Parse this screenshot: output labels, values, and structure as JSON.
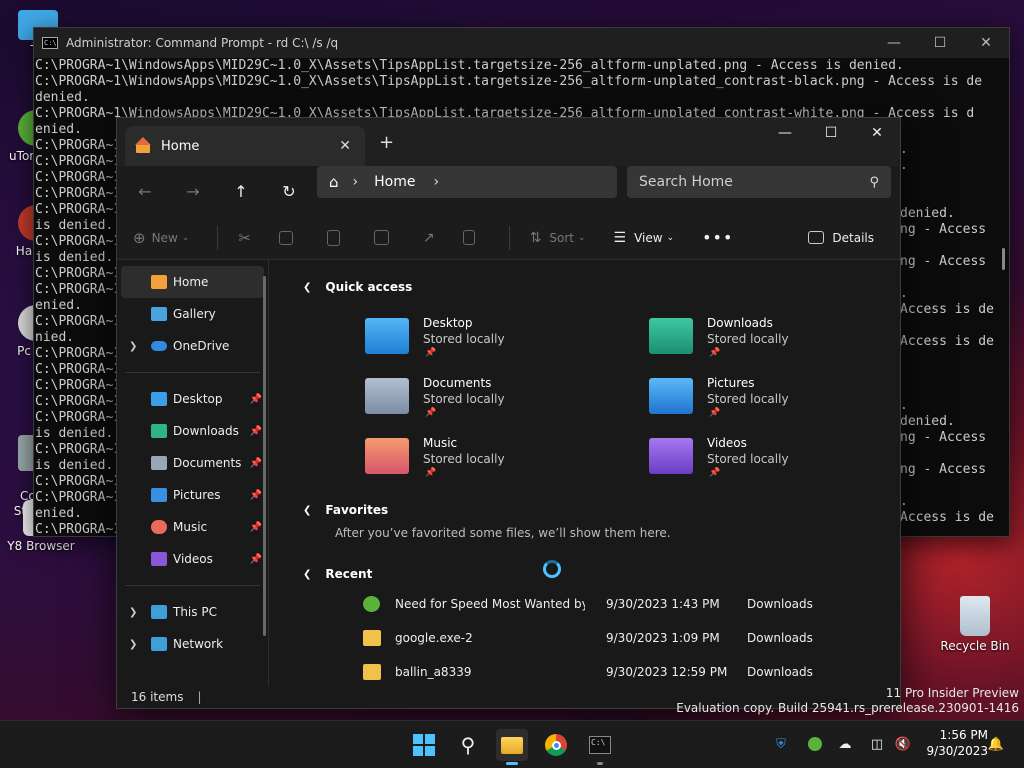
{
  "desktop": {
    "icons": [
      {
        "label": "Th",
        "icon": "monitor-icon"
      },
      {
        "label": "uTorr",
        "icon": "utorrent-icon"
      },
      {
        "label": "Ha",
        "icon": "app-icon"
      },
      {
        "label": "Pc",
        "icon": "app-icon"
      },
      {
        "label": "Co\nStri",
        "icon": "app-icon"
      },
      {
        "label": "Y8 Browser",
        "icon": "y8-browser-icon"
      },
      {
        "label": "Recycle Bin",
        "icon": "recycle-bin-icon"
      }
    ],
    "watermark_line1": "11 Pro Insider Preview",
    "watermark_line2": "Evaluation copy. Build 25941.rs_prerelease.230901-1416"
  },
  "cmd": {
    "title": "Administrator: Command Prompt - rd  C:\\ /s /q",
    "lines": [
      "C:\\PROGRA~1\\WindowsApps\\MID29C~1.0_X\\Assets\\TipsAppList.targetsize-256_altform-unplated.png - Access is denied.",
      "C:\\PROGRA~1\\WindowsApps\\MID29C~1.0_X\\Assets\\TipsAppList.targetsize-256_altform-unplated_contrast-black.png - Access is de",
      "denied.",
      "C:\\PROGRA~1\\WindowsApps\\MID29C~1.0_X\\Assets\\TipsAppList.targetsize-256_altform-unplated_contrast-white.png - Access is d",
      "enied.",
      "C:\\PROGRA~1",
      "C:\\PROGRA~1",
      "C:\\PROGRA~1",
      "C:\\PROGRA~1",
      "C:\\PROGRA~1",
      "is denied.",
      "C:\\PROGRA~1",
      "is denied.",
      "C:\\PROGRA~1",
      "C:\\PROGRA~1",
      "enied.",
      "C:\\PROGRA~1",
      "nied.",
      "C:\\PROGRA~1",
      "C:\\PROGRA~1",
      "C:\\PROGRA~1",
      "C:\\PROGRA~1",
      "C:\\PROGRA~1",
      "is denied.",
      "C:\\PROGRA~1",
      "is denied.",
      "C:\\PROGRA~1",
      "C:\\PROGRA~1",
      "enied.",
      "C:\\PROGRA~1",
      "nied."
    ],
    "right_fragments": [
      ".",
      ".",
      "",
      "",
      "denied.",
      "ng - Access",
      "",
      "ng - Access",
      "",
      ".",
      "Access is de",
      "",
      "Access is de",
      "",
      "",
      "",
      ".",
      "denied.",
      "ng - Access",
      "",
      "ng - Access",
      "",
      ".",
      "Access is de"
    ]
  },
  "explorer": {
    "tab_title": "Home",
    "address": "Home",
    "search_placeholder": "Search Home",
    "toolbar": {
      "new": "New",
      "sort": "Sort",
      "view": "View",
      "details": "Details"
    },
    "nav": {
      "top": [
        {
          "label": "Home",
          "icon": "home-icon",
          "selected": true,
          "color": "#f3a13a"
        },
        {
          "label": "Gallery",
          "icon": "gallery-icon",
          "color": "#4aa3df"
        },
        {
          "label": "OneDrive",
          "icon": "onedrive-icon",
          "color": "#2f8ae0",
          "expandable": true
        }
      ],
      "pinned": [
        {
          "label": "Desktop",
          "icon": "desktop-folder-icon",
          "color": "#3c9ee6"
        },
        {
          "label": "Downloads",
          "icon": "downloads-icon",
          "color": "#2fb38a"
        },
        {
          "label": "Documents",
          "icon": "documents-icon",
          "color": "#9aa6b8"
        },
        {
          "label": "Pictures",
          "icon": "pictures-icon",
          "color": "#3a8fe0"
        },
        {
          "label": "Music",
          "icon": "music-icon",
          "color": "#e86a5a"
        },
        {
          "label": "Videos",
          "icon": "videos-icon",
          "color": "#8a55d6"
        }
      ],
      "bottom": [
        {
          "label": "This PC",
          "icon": "this-pc-icon",
          "color": "#3da0d8"
        },
        {
          "label": "Network",
          "icon": "network-icon",
          "color": "#3da0d8"
        }
      ]
    },
    "quick_access_title": "Quick access",
    "quick_access": [
      {
        "name": "Desktop",
        "sub": "Stored locally",
        "icon": "desktop-folder-icon",
        "color": "#2d8fe0"
      },
      {
        "name": "Downloads",
        "sub": "Stored locally",
        "icon": "downloads-folder-icon",
        "color": "#27a98a"
      },
      {
        "name": "Documents",
        "sub": "Stored locally",
        "icon": "documents-folder-icon",
        "color": "#8a9bb4"
      },
      {
        "name": "Pictures",
        "sub": "Stored locally",
        "icon": "pictures-folder-icon",
        "color": "#2d8fe0"
      },
      {
        "name": "Music",
        "sub": "Stored locally",
        "icon": "music-folder-icon",
        "color": "#e8725f"
      },
      {
        "name": "Videos",
        "sub": "Stored locally",
        "icon": "videos-folder-icon",
        "color": "#8050d0"
      }
    ],
    "favorites_title": "Favorites",
    "favorites_empty": "After you’ve favorited some files, we’ll show them here.",
    "recent_title": "Recent",
    "recent": [
      {
        "name": "Need for Speed Most Wanted by...",
        "date": "9/30/2023 1:43 PM",
        "location": "Downloads",
        "icon": "utorrent-icon",
        "color": "#59b33a"
      },
      {
        "name": "google.exe-2",
        "date": "9/30/2023 1:09 PM",
        "location": "Downloads",
        "icon": "folder-icon",
        "color": "#f0c24a"
      },
      {
        "name": "ballin_a8339",
        "date": "9/30/2023 12:59 PM",
        "location": "Downloads",
        "icon": "folder-icon",
        "color": "#f0c24a"
      }
    ],
    "status": "16 items"
  },
  "taskbar": {
    "apps": [
      "start-icon",
      "search-icon",
      "file-explorer-icon",
      "chrome-icon",
      "terminal-icon"
    ],
    "time": "1:56 PM",
    "date": "9/30/2023"
  }
}
